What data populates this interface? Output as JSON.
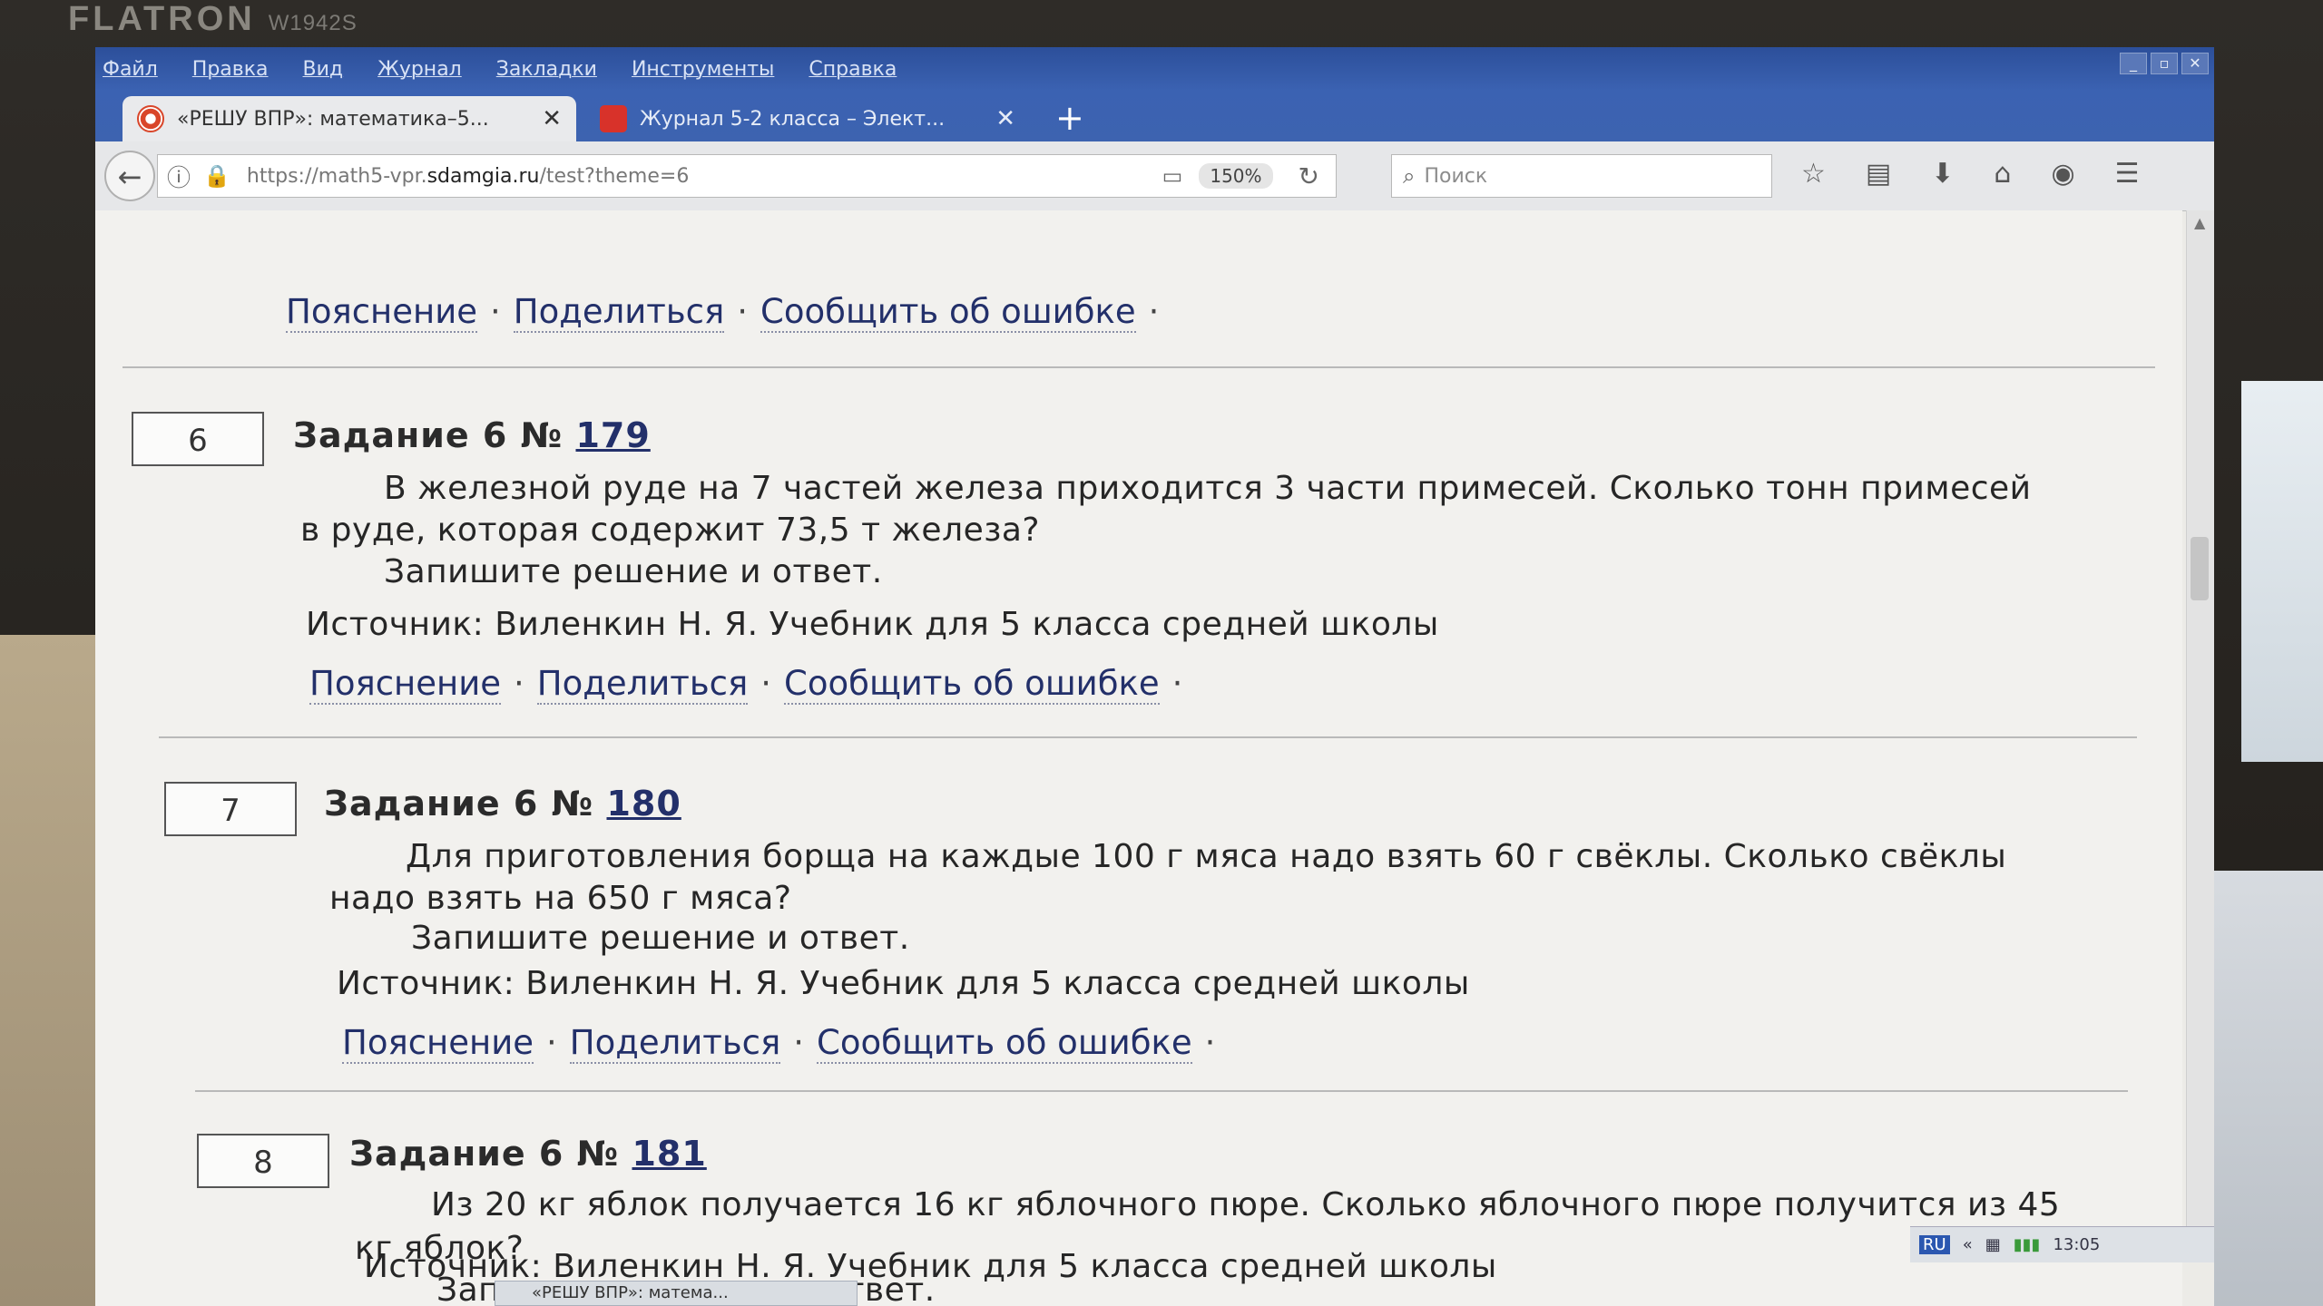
{
  "monitor": {
    "brand": "FLATRON",
    "model": "W1942S"
  },
  "menu": [
    "Файл",
    "Правка",
    "Вид",
    "Журнал",
    "Закладки",
    "Инструменты",
    "Справка"
  ],
  "window_controls": [
    "_",
    "▫",
    "✕"
  ],
  "tabs": [
    {
      "label": "«РЕШУ ВПР»: математика–5...",
      "close": "✕"
    },
    {
      "label": "Журнал 5-2 класса – Элект...",
      "close": "✕"
    }
  ],
  "new_tab": "+",
  "nav": {
    "back": "←",
    "info": "ⓘ",
    "lock": "🔒",
    "url_prefix": "https://math5-vpr.",
    "url_domain": "sdamgia.ru",
    "url_suffix": "/test?theme=6",
    "reader": "▭",
    "zoom": "150%",
    "reload": "↻",
    "search_icon": "⌕",
    "search_placeholder": "Поиск",
    "tools": [
      "☆",
      "▤",
      "⬇",
      "⌂",
      "◉",
      "☰"
    ]
  },
  "links": {
    "explain": "Пояснение",
    "share": "Поделиться",
    "report": "Сообщить об ошибке",
    "dot": "·"
  },
  "tasks": [
    {
      "num": "6",
      "title": "Задание 6 №",
      "id": "179",
      "line1": "В железной руде на 7 частей железа приходится 3 части примесей. Сколько тонн примесей",
      "line2": "в руде, которая содержит 73,5 т железа?",
      "line3": "Запишите решение и ответ.",
      "source": "Источник: Виленкин Н. Я. Учебник для 5 класса средней школы"
    },
    {
      "num": "7",
      "title": "Задание 6 №",
      "id": "180",
      "line1": "Для приготовления борща на каждые 100 г мяса надо взять 60 г свёклы. Сколько свёклы",
      "line2": "надо взять на 650 г мяса?",
      "line3": "Запишите решение и ответ.",
      "source": "Источник: Виленкин Н. Я. Учебник для 5 класса средней школы"
    },
    {
      "num": "8",
      "title": "Задание 6 №",
      "id": "181",
      "line1": "Из 20 кг яблок получается 16 кг яблочного пюре. Сколько яблочного пюре получится из 45",
      "line2": "кг яблок?",
      "line3": "Запишите решение и ответ.",
      "source": "Источник: Виленкин Н. Я. Учебник для 5 класса средней школы"
    }
  ],
  "taskbar": {
    "lang": "RU",
    "tray": "«",
    "time": "13:05",
    "item": "«РЕШУ ВПР»: матема..."
  }
}
